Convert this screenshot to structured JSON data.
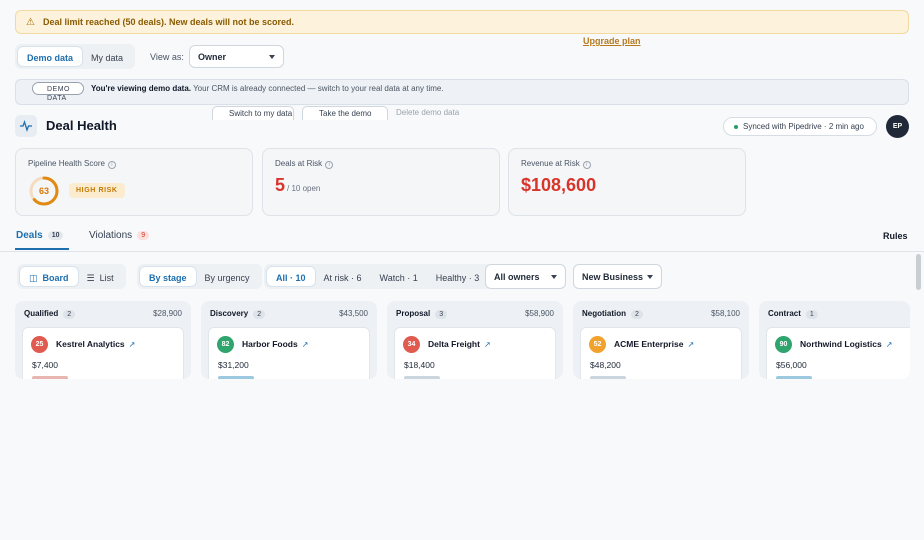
{
  "banner": {
    "icon": "warning-icon",
    "text": "Deal limit reached (50 deals). New deals will not be scored.",
    "upgrade_label": "Upgrade plan"
  },
  "toolbar": {
    "data_toggle": [
      {
        "label": "Demo data",
        "active": true
      },
      {
        "label": "My data",
        "active": false
      }
    ],
    "view_as_label": "View as:",
    "view_as_value": "Owner"
  },
  "demo_notice": {
    "pill": "DEMO DATA",
    "bold": "You're viewing demo data.",
    "text": " Your CRM is already connected — switch to your real data at any time.",
    "switch_button": "Switch to my data",
    "demo_button": "Take the demo",
    "delete_link": "Delete demo data"
  },
  "header": {
    "title": "Deal Health",
    "icon": "pulse-icon",
    "sync": "Synced with Pipedrive · 2 min ago",
    "avatar": "EP"
  },
  "metrics": {
    "health": {
      "label": "Pipeline Health Score",
      "score": "63",
      "score_fraction": 0.63,
      "risk": "HIGH RISK"
    },
    "at_risk": {
      "label": "Deals at Risk",
      "value": "5",
      "sub": "/ 10 open"
    },
    "revenue": {
      "label": "Revenue at Risk",
      "value": "$108,600"
    }
  },
  "tabs": [
    {
      "label": "Deals",
      "count": "10",
      "active": true
    },
    {
      "label": "Violations",
      "count": "9",
      "active": false
    }
  ],
  "rules_label": "Rules",
  "filters": {
    "views": [
      {
        "label": "Board",
        "icon": "board-icon",
        "active": true
      },
      {
        "label": "List",
        "icon": "list-icon",
        "active": false
      }
    ],
    "grouping": [
      {
        "label": "By stage",
        "active": true
      },
      {
        "label": "By urgency",
        "active": false
      }
    ],
    "status": [
      {
        "label": "All · 10",
        "active": true
      },
      {
        "label": "At risk · 6",
        "active": false
      },
      {
        "label": "Watch · 1",
        "active": false
      },
      {
        "label": "Healthy · 3",
        "active": false
      }
    ],
    "owner": "All owners",
    "pipeline": "New Business"
  },
  "colors": {
    "critical": "#e05a4f",
    "good": "#2fa46c",
    "warn": "#f0a22c"
  },
  "columns": [
    {
      "stage": "Qualified",
      "count": "2",
      "total": "$28,900",
      "deal": {
        "score": "25",
        "name": "Kestrel Analytics",
        "amount": "$7,400",
        "color": "#e05a4f",
        "stub": "red"
      }
    },
    {
      "stage": "Discovery",
      "count": "2",
      "total": "$43,500",
      "deal": {
        "score": "82",
        "name": "Harbor Foods",
        "amount": "$31,200",
        "color": "#2fa46c",
        "stub": "blue"
      }
    },
    {
      "stage": "Proposal",
      "count": "3",
      "total": "$58,900",
      "deal": {
        "score": "34",
        "name": "Delta Freight",
        "amount": "$18,400",
        "color": "#e05a4f",
        "stub": "gray"
      }
    },
    {
      "stage": "Negotiation",
      "count": "2",
      "total": "$58,100",
      "deal": {
        "score": "52",
        "name": "ACME Enterprise",
        "amount": "$48,200",
        "color": "#f0a22c",
        "stub": "gray"
      }
    },
    {
      "stage": "Contract",
      "count": "1",
      "total": "$56,000",
      "deal": {
        "score": "90",
        "name": "Northwind Logistics",
        "amount": "$56,000",
        "color": "#2fa46c",
        "stub": "blue"
      }
    }
  ]
}
